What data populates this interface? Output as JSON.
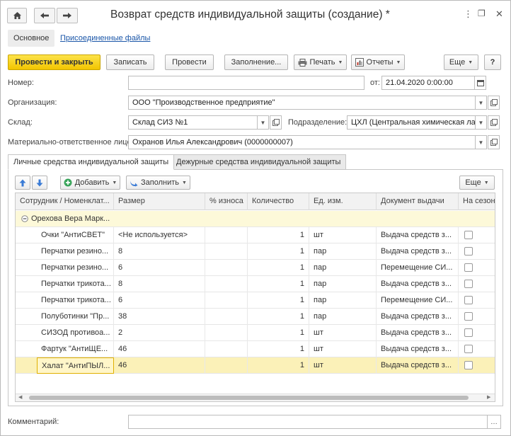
{
  "window": {
    "title": "Возврат средств индивидуальной защиты (создание) *",
    "more_icon": "⋮",
    "restore_icon": "❐",
    "close_icon": "✕"
  },
  "sections": {
    "main": "Основное",
    "attached": "Присоединенные файлы"
  },
  "toolbar": {
    "post_close": "Провести и закрыть",
    "save": "Записать",
    "post": "Провести",
    "fill": "Заполнение...",
    "print": "Печать",
    "reports": "Отчеты",
    "more": "Еще",
    "help": "?"
  },
  "form": {
    "number_label": "Номер:",
    "number_value": "",
    "date_label": "от:",
    "date_value": "21.04.2020  0:00:00",
    "org_label": "Организация:",
    "org_value": "ООО \"Производственное предприятие\"",
    "warehouse_label": "Склад:",
    "warehouse_value": "Склад СИЗ №1",
    "division_label": "Подразделение:",
    "division_value": "ЦХЛ (Центральная химическая лабо",
    "responsible_label": "Материально-ответственное лицо:",
    "responsible_value": "Охранов Илья Александрович (0000000007)",
    "comment_label": "Комментарий:",
    "comment_value": ""
  },
  "tabs": {
    "personal": "Личные средства индивидуальной защиты",
    "duty": "Дежурные средства индивидуальной защиты"
  },
  "table_toolbar": {
    "add": "Добавить",
    "fill": "Заполнить",
    "more": "Еще"
  },
  "table": {
    "columns": [
      "Сотрудник / Номенклат...",
      "Размер",
      "% износа",
      "Количество",
      "Ед. изм.",
      "Документ выдачи",
      "На сезон"
    ],
    "group": "Орехова Вера Марк...",
    "rows": [
      {
        "name": "Очки \"АнтиСВЕТ\"",
        "size": "<Не используется>",
        "wear": "",
        "qty": "1",
        "unit": "шт",
        "doc": "Выдача средств з...",
        "season": false
      },
      {
        "name": "Перчатки резино...",
        "size": "8",
        "wear": "",
        "qty": "1",
        "unit": "пар",
        "doc": "Выдача средств з...",
        "season": false
      },
      {
        "name": "Перчатки резино...",
        "size": "6",
        "wear": "",
        "qty": "1",
        "unit": "пар",
        "doc": "Перемещение СИ...",
        "season": false
      },
      {
        "name": "Перчатки трикота...",
        "size": "8",
        "wear": "",
        "qty": "1",
        "unit": "пар",
        "doc": "Выдача средств з...",
        "season": false
      },
      {
        "name": "Перчатки трикота...",
        "size": "6",
        "wear": "",
        "qty": "1",
        "unit": "пар",
        "doc": "Перемещение СИ...",
        "season": false
      },
      {
        "name": "Полуботинки \"Пр...",
        "size": "38",
        "wear": "",
        "qty": "1",
        "unit": "пар",
        "doc": "Выдача средств з...",
        "season": false
      },
      {
        "name": "СИЗОД противоа...",
        "size": "2",
        "wear": "",
        "qty": "1",
        "unit": "шт",
        "doc": "Выдача средств з...",
        "season": false
      },
      {
        "name": "Фартук \"АнтиЩЕ...",
        "size": "46",
        "wear": "",
        "qty": "1",
        "unit": "шт",
        "doc": "Выдача средств з...",
        "season": false
      },
      {
        "name": "Халат \"АнтиПЫЛ...",
        "size": "46",
        "wear": "",
        "qty": "1",
        "unit": "шт",
        "doc": "Выдача средств з...",
        "season": false
      }
    ],
    "selected_row": 8
  }
}
